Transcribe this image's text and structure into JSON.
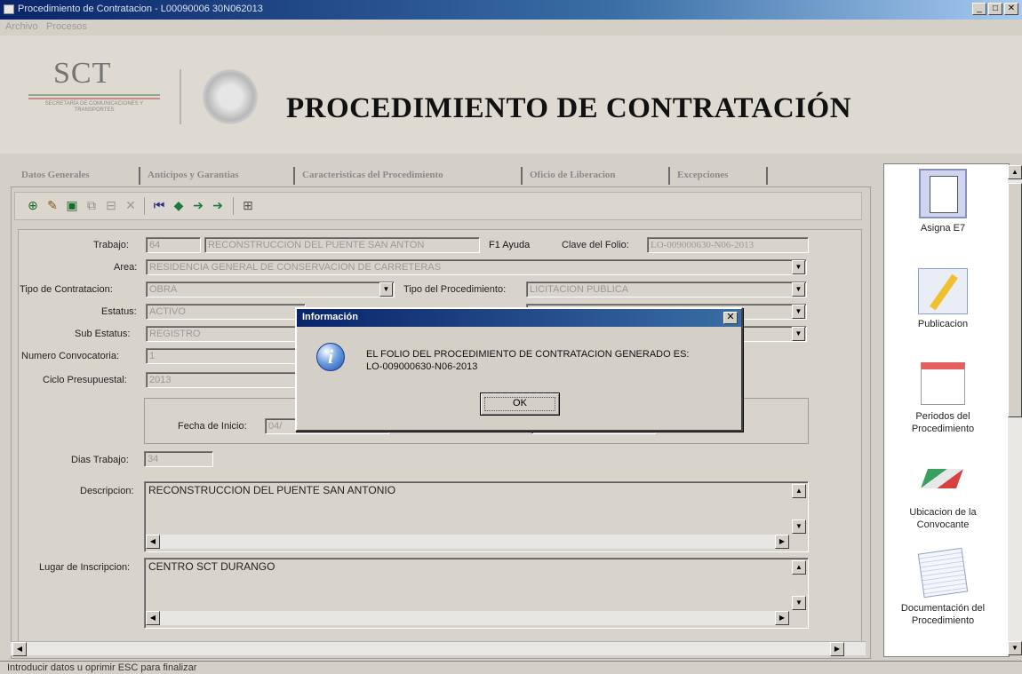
{
  "window": {
    "title": "Procedimiento de Contratacion - L00090006 30N062013",
    "minimize": "_",
    "maximize": "□",
    "close": "✕"
  },
  "menu": [
    "Archivo",
    "Procesos"
  ],
  "banner": {
    "logo_text": "SCT",
    "logo_subtitle": "SECRETARÍA DE COMUNICACIONES Y TRANSPORTES",
    "title": "PROCEDIMIENTO DE CONTRATACIÓN"
  },
  "tabs": [
    "Datos Generales",
    "Anticipos y Garantias",
    "Caracteristicas del Procedimiento",
    "Oficio de Liberacion",
    "Excepciones"
  ],
  "form": {
    "trabajo_label": "Trabajo:",
    "trabajo_num": "64",
    "trabajo_name": "RECONSTRUCCION DEL PUENTE SAN ANTON",
    "ayuda": "F1 Ayuda",
    "clave_folio_label": "Clave del Folio:",
    "clave_folio": "LO-009000630-N06-2013",
    "area_label": "Area:",
    "area": "RESIDENCIA GENERAL DE CONSERVACION DE CARRETERAS",
    "tipo_contratacion_label": "Tipo de Contratacion:",
    "tipo_contratacion": "OBRA",
    "tipo_procedimiento_label": "Tipo del Procedimiento:",
    "tipo_procedimiento": "LICITACION PUBLICA",
    "estatus_label": "Estatus:",
    "estatus": "ACTIVO",
    "sub_estatus_label": "Sub Estatus:",
    "sub_estatus": "REGISTRO",
    "num_convocatoria_label": "Numero Convocatoria:",
    "num_convocatoria": "1",
    "ciclo_label": "Ciclo Presupuestal:",
    "ciclo": "2013",
    "fecha_inicio_label": "Fecha de Inicio:",
    "fecha_inicio": "04/",
    "dias_label": "Dias Trabajo:",
    "dias": "34",
    "descripcion_label": "Descripcion:",
    "descripcion": "RECONSTRUCCION DEL PUENTE SAN ANTONIO",
    "lugar_label": "Lugar de Inscripcion:",
    "lugar": "CENTRO SCT DURANGO"
  },
  "dialog": {
    "title": "Información",
    "message": "EL FOLIO DEL PROCEDIMIENTO DE CONTRATACION GENERADO ES:\nLO-009000630-N06-2013",
    "ok": "OK",
    "close": "✕"
  },
  "sidebar": [
    {
      "label": "Asigna E7",
      "icon": "document-list-icon"
    },
    {
      "label": "Publicacion",
      "icon": "publish-pen-icon"
    },
    {
      "label": "Periodos del Procedimiento",
      "icon": "calendar-icon"
    },
    {
      "label": "Ubicacion de la Convocante",
      "icon": "map-icon"
    },
    {
      "label": "Documentación del Procedimiento",
      "icon": "documents-icon"
    }
  ],
  "status": "Introducir datos u oprimir ESC para finalizar"
}
